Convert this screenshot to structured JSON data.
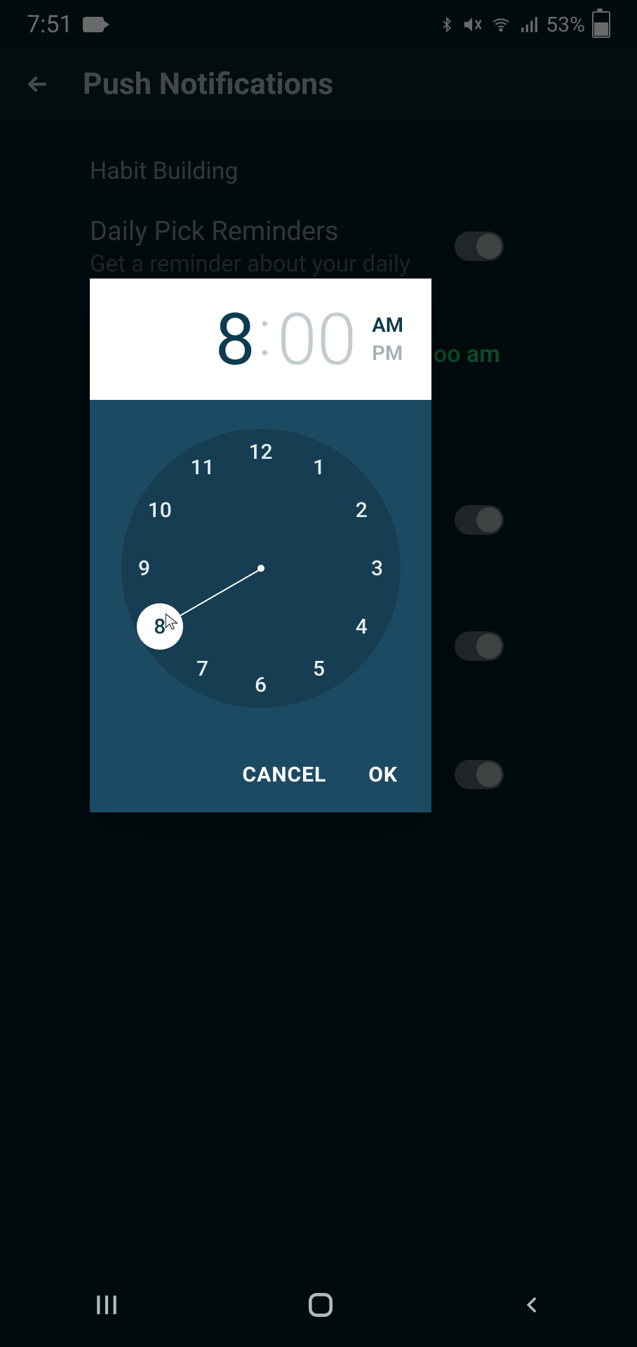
{
  "status": {
    "time": "7:51",
    "battery_pct": "53%"
  },
  "app_bar": {
    "title": "Push Notifications"
  },
  "settings": {
    "section": "Habit Building",
    "daily_pick": {
      "title": "Daily Pick Reminders",
      "subtitle": "Get a reminder about your daily recommendation",
      "toggle_on": true
    },
    "time_peek": "oo am"
  },
  "time_picker": {
    "hour": "8",
    "minute": "00",
    "am": "AM",
    "pm": "PM",
    "selected_hour_index": 8,
    "cancel": "CANCEL",
    "ok": "OK",
    "numbers": [
      "12",
      "1",
      "2",
      "3",
      "4",
      "5",
      "6",
      "7",
      "8",
      "9",
      "10",
      "11"
    ]
  },
  "colors": {
    "bg": "#021a21",
    "dialog_bg": "#1d4a63",
    "clock_face": "#163d52",
    "accent_green": "#1fa85a",
    "text_dim": "#6d7d83"
  }
}
